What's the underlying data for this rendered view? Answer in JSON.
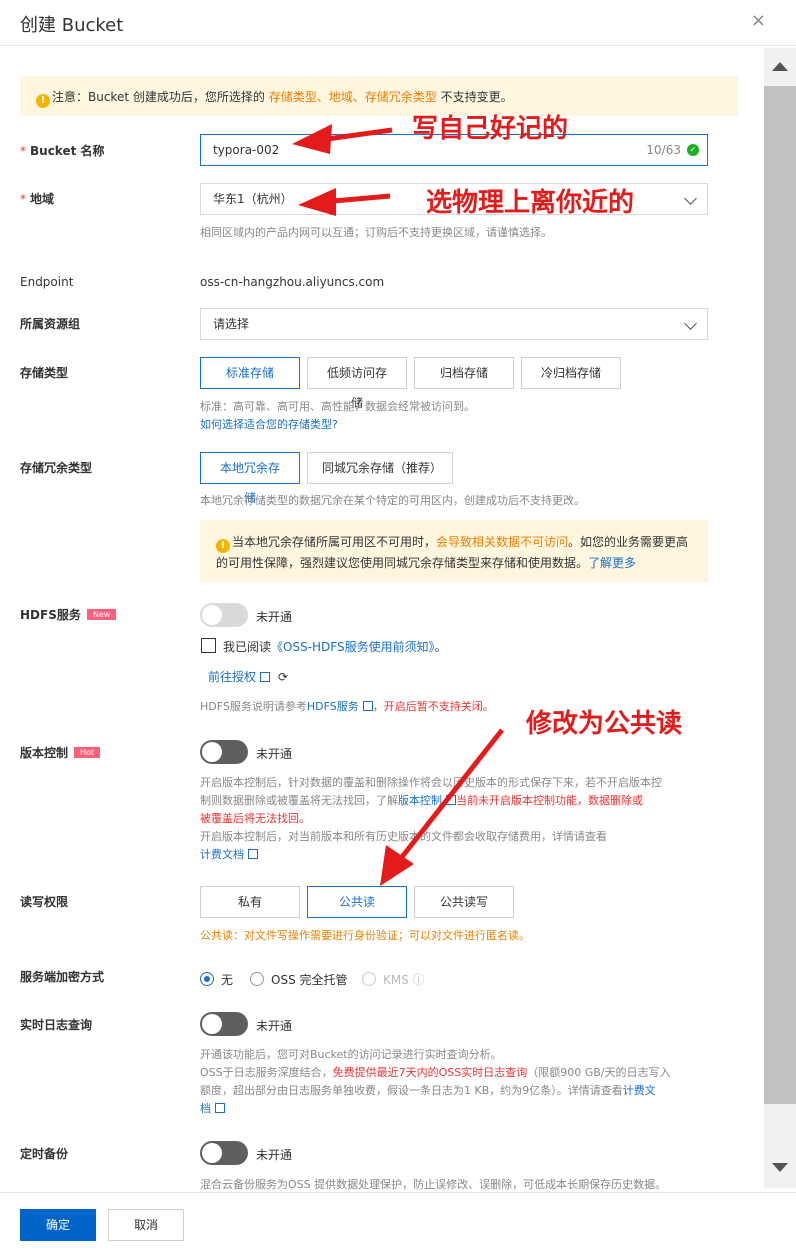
{
  "dialog": {
    "title": "创建 Bucket",
    "close": "×"
  },
  "notice": {
    "prefix": "注意：Bucket 创建成功后，您所选择的 ",
    "hl1": "存储类型",
    "sep1": "、",
    "hl2": "地域",
    "sep2": "、",
    "hl3": "存储冗余类型",
    "suffix": " 不支持变更。"
  },
  "bucket_name": {
    "label": "Bucket 名称",
    "value": "typora-002",
    "counter": "10/63"
  },
  "region": {
    "label": "地域",
    "value": "华东1（杭州）",
    "hint": "相同区域内的产品内网可以互通；订购后不支持更换区域，请谨慎选择。"
  },
  "endpoint": {
    "label": "Endpoint",
    "value": "oss-cn-hangzhou.aliyuncs.com"
  },
  "resource_group": {
    "label": "所属资源组",
    "placeholder": "请选择"
  },
  "storage_class": {
    "label": "存储类型",
    "options": [
      "标准存储",
      "低频访问存储",
      "归档存储",
      "冷归档存储"
    ],
    "selected": "标准存储",
    "hint": "标准：高可靠、高可用、高性能，数据会经常被访问到。",
    "link": "如何选择适合您的存储类型?"
  },
  "redundancy": {
    "label": "存储冗余类型",
    "options": [
      "本地冗余存储",
      "同城冗余存储（推荐）"
    ],
    "hint": "本地冗余存储类型的数据冗余在某个特定的可用区内，创建成功后不支持更改。",
    "alert_a": "当本地冗余存储所属可用区不可用时，",
    "alert_b": "会导致相关数据不可访问",
    "alert_c": "。如您的业务需要更高",
    "alert_d": "的可用性保障，强烈建议您使用同城冗余存储类型来存储和使用数据。",
    "alert_link": "了解更多"
  },
  "hdfs": {
    "label": "HDFS服务",
    "badge": "New",
    "status": "未开通",
    "agree_prefix": "我已阅读",
    "agree_link": "《OSS-HDFS服务使用前须知》",
    "agree_suffix": "。",
    "auth_link": "前往授权",
    "hint_a": "HDFS服务说明请参考",
    "hint_link": "HDFS服务",
    "hint_b": "，开启后暂不支持关闭。"
  },
  "versioning": {
    "label": "版本控制",
    "badge": "Hot",
    "status": "未开通",
    "hint1": "开启版本控制后，针对数据的覆盖和删除操作将会以历史版本的形式保存下来，若不开启版本控",
    "hint2a": "制则数据删除或被覆盖将无法找回，了解",
    "hint2link": "版本控制",
    "hint2b": "当前未开启版本控制功能，数据删除或",
    "hint3": "被覆盖后将无法找回。",
    "hint4": "开启版本控制后，对当前版本和所有历史版本的文件都会收取存储费用，详情请查看",
    "hint5": "计费文档"
  },
  "acl": {
    "label": "读写权限",
    "options": [
      "私有",
      "公共读",
      "公共读写"
    ],
    "selected": "公共读",
    "warn": "公共读：对文件写操作需要进行身份验证；可以对文件进行匿名读。"
  },
  "encryption": {
    "label": "服务端加密方式",
    "options": [
      "无",
      "OSS 完全托管",
      "KMS"
    ]
  },
  "realtime_log": {
    "label": "实时日志查询",
    "status": "未开通",
    "hint1": "开通该功能后，您可对Bucket的访问记录进行实时查询分析。",
    "hint2a": "OSS于日志服务深度结合，",
    "hint2b": "免费提供最近7天内的OSS实时日志查询",
    "hint2c": "（限额900 GB/天的日志写入",
    "hint3a": "额度，超出部分由日志服务单独收费，假设一条日志为1 KB，约为9亿条）。详情请查看",
    "hint3link": "计费文",
    "hint4": "档"
  },
  "backup": {
    "label": "定时备份",
    "status": "未开通",
    "hint": "混合云备份服务为OSS 提供数据处理保护，防止误修改、误删除，可低成本长期保存历史数据。"
  },
  "footer": {
    "confirm": "确定",
    "cancel": "取消"
  },
  "annotations": {
    "a1": "写自己好记的",
    "a2": "选物理上离你近的",
    "a3": "修改为公共读"
  },
  "colors": {
    "primary": "#0064c8",
    "link": "#1a6fc8",
    "annotation": "#e31b1b",
    "warning_bg": "#fff6e0"
  }
}
